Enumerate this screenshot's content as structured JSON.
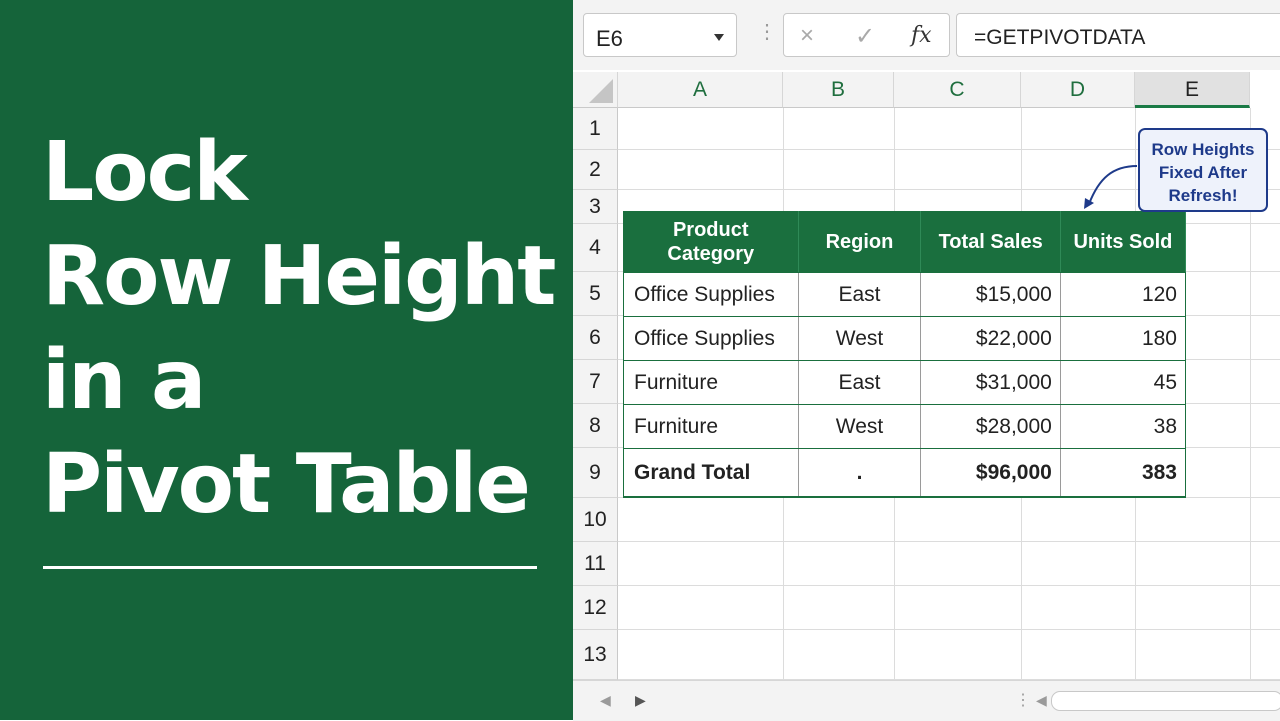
{
  "title": {
    "lines": [
      "Lock",
      "Row Height",
      "in a",
      "Pivot Table"
    ]
  },
  "formula_bar": {
    "name_box": "E6",
    "cancel_icon": "×",
    "enter_icon": "✓",
    "fx_label": "fx",
    "formula": "=GETPIVOTDATA"
  },
  "columns": [
    "A",
    "B",
    "C",
    "D",
    "E"
  ],
  "selected_column": "E",
  "rows": [
    "1",
    "2",
    "3",
    "4",
    "5",
    "6",
    "7",
    "8",
    "9",
    "10",
    "11",
    "12",
    "13"
  ],
  "pivot": {
    "headers": [
      "Product Category",
      "Region",
      "Total Sales",
      "Units Sold"
    ],
    "rows": [
      [
        "Office Supplies",
        "East",
        "$15,000",
        "120"
      ],
      [
        "Office Supplies",
        "West",
        "$22,000",
        "180"
      ],
      [
        "Furniture",
        "East",
        "$31,000",
        "45"
      ],
      [
        "Furniture",
        "West",
        "$28,000",
        "38"
      ]
    ],
    "total": [
      "Grand Total",
      ".",
      "$96,000",
      "383"
    ]
  },
  "callout": {
    "text": "Row Heights Fixed After Refresh!"
  },
  "colors": {
    "left_panel": "#15643a",
    "pivot_header": "#1a6f3e",
    "callout": "#1e3a8a"
  }
}
